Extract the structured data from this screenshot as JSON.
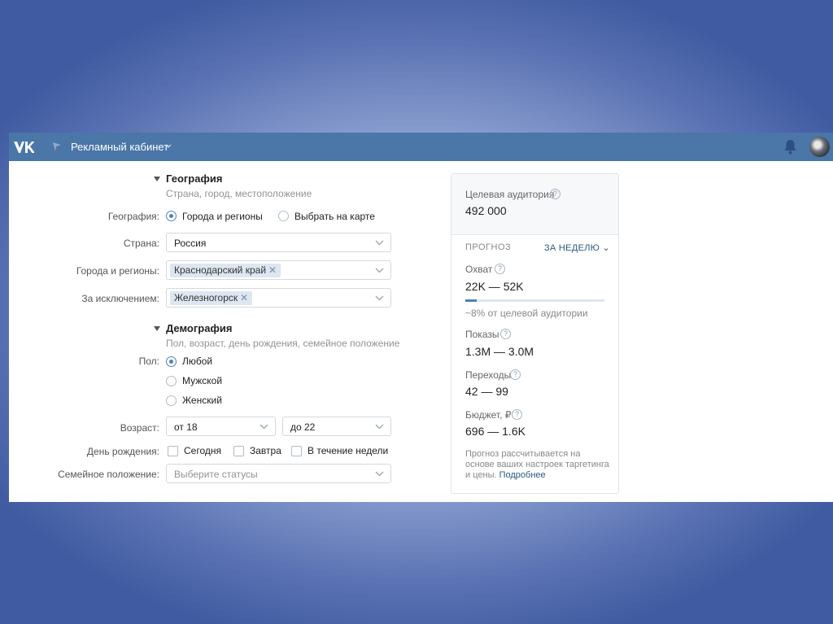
{
  "header": {
    "title": "Рекламный кабинет",
    "logo": "vk-logo",
    "brand_color": "#4a76a8"
  },
  "geography": {
    "title": "География",
    "subtitle": "Страна, город, местоположение",
    "mode_label": "География:",
    "mode_options": [
      "Города и регионы",
      "Выбрать на карте"
    ],
    "mode_selected": "Города и регионы",
    "country_label": "Страна:",
    "country_value": "Россия",
    "cities_label": "Города и регионы:",
    "cities_tags": [
      "Краснодарский край"
    ],
    "exclude_label": "За исключением:",
    "exclude_tags": [
      "Железногорск"
    ]
  },
  "demography": {
    "title": "Демография",
    "subtitle": "Пол, возраст, день рождения, семейное положение",
    "gender_label": "Пол:",
    "gender_options": [
      "Любой",
      "Мужской",
      "Женский"
    ],
    "gender_selected": "Любой",
    "age_label": "Возраст:",
    "age_from": "от 18",
    "age_to": "до 22",
    "birthday_label": "День рождения:",
    "birthday_options": [
      "Сегодня",
      "Завтра",
      "В течение недели"
    ],
    "family_label": "Семейное положение:",
    "family_placeholder": "Выберите статусы"
  },
  "forecast": {
    "audience_label": "Целевая аудитория",
    "audience_value": "492 000",
    "forecast_label": "ПРОГНОЗ",
    "period_link": "ЗА НЕДЕЛЮ",
    "reach_label": "Охват",
    "reach_value": "22K — 52K",
    "reach_fraction": 0.08,
    "reach_note": "~8% от целевой аудитории",
    "impressions_label": "Показы",
    "impressions_value": "1.3M — 3.0M",
    "clicks_label": "Переходы",
    "clicks_value": "42 — 99",
    "budget_label": "Бюджет, ₽",
    "budget_value": "696 — 1.6K",
    "note_text": "Прогноз рассчитывается на основе ваших настроек таргетинга и цены.",
    "note_link": "Подробнее"
  }
}
